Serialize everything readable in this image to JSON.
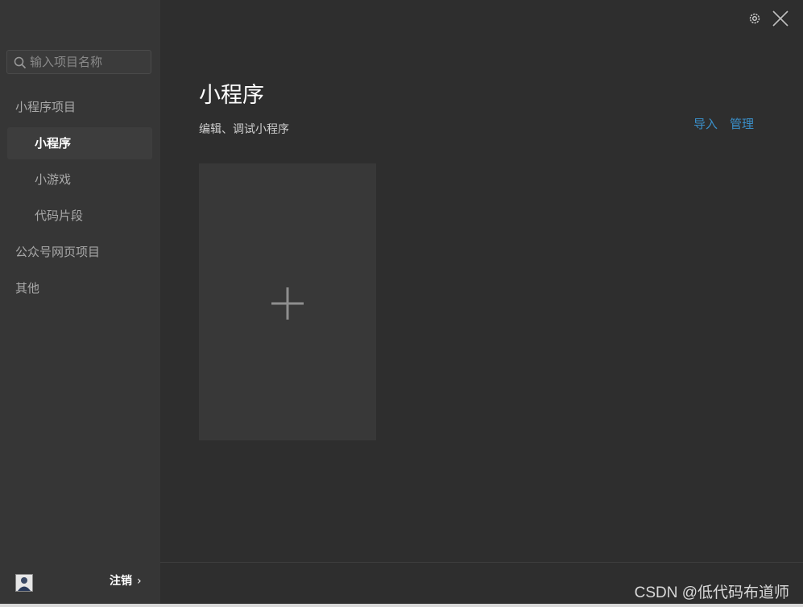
{
  "search": {
    "placeholder": "输入项目名称"
  },
  "sidebar": {
    "groups": [
      {
        "label": "小程序项目"
      },
      {
        "label": "公众号网页项目"
      },
      {
        "label": "其他"
      }
    ],
    "items": [
      {
        "label": "小程序",
        "active": true
      },
      {
        "label": "小游戏",
        "active": false
      },
      {
        "label": "代码片段",
        "active": false
      }
    ],
    "footer": {
      "logout_label": "注销",
      "chevron": "›"
    }
  },
  "main": {
    "title": "小程序",
    "subtitle": "编辑、调试小程序",
    "actions": {
      "import": "导入",
      "manage": "管理"
    }
  },
  "watermark": "CSDN @低代码布道师",
  "colors": {
    "sidebar_bg": "#363636",
    "main_bg": "#2e2e2e",
    "link": "#3a8fc9",
    "card_bg": "#383838"
  },
  "icons": [
    "search-icon",
    "gear-icon",
    "close-icon",
    "plus-icon",
    "avatar"
  ]
}
